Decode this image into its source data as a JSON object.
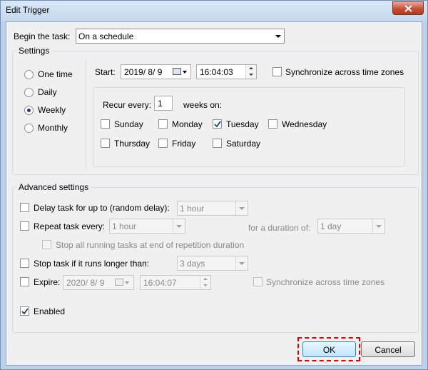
{
  "window": {
    "title": "Edit Trigger"
  },
  "begin": {
    "label": "Begin the task:",
    "value": "On a schedule"
  },
  "settings": {
    "title": "Settings",
    "schedule_options": [
      {
        "label": "One time",
        "selected": false
      },
      {
        "label": "Daily",
        "selected": false
      },
      {
        "label": "Weekly",
        "selected": true
      },
      {
        "label": "Monthly",
        "selected": false
      }
    ],
    "start_label": "Start:",
    "start_date": "2019/ 8/ 9",
    "start_time": "16:04:03",
    "sync_label": "Synchronize across time zones",
    "recur_label": "Recur every:",
    "recur_value": "1",
    "weeks_on_label": "weeks on:",
    "days": [
      {
        "label": "Sunday",
        "checked": false
      },
      {
        "label": "Monday",
        "checked": false
      },
      {
        "label": "Tuesday",
        "checked": true
      },
      {
        "label": "Wednesday",
        "checked": false
      },
      {
        "label": "Thursday",
        "checked": false
      },
      {
        "label": "Friday",
        "checked": false
      },
      {
        "label": "Saturday",
        "checked": false
      }
    ]
  },
  "advanced": {
    "title": "Advanced settings",
    "delay_label": "Delay task for up to (random delay):",
    "delay_value": "1 hour",
    "repeat_label": "Repeat task every:",
    "repeat_value": "1 hour",
    "duration_label": "for a duration of:",
    "duration_value": "1 day",
    "stop_running_label": "Stop all running tasks at end of repetition duration",
    "stop_longer_label": "Stop task if it runs longer than:",
    "stop_longer_value": "3 days",
    "expire_label": "Expire:",
    "expire_date": "2020/ 8/ 9",
    "expire_time": "16:04:07",
    "expire_sync_label": "Synchronize across time zones",
    "enabled_label": "Enabled",
    "enabled_checked": true
  },
  "buttons": {
    "ok": "OK",
    "cancel": "Cancel"
  },
  "colors": {
    "highlight": "#e00000",
    "accent": "#3c7fb1"
  }
}
